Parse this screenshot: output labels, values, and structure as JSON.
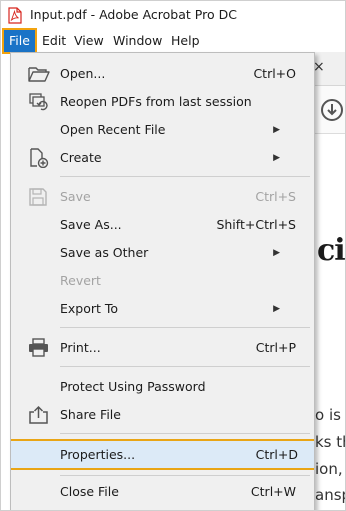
{
  "window": {
    "title": "Input.pdf - Adobe Acrobat Pro DC"
  },
  "menubar": {
    "file": "File",
    "edit": "Edit",
    "view": "View",
    "window": "Window",
    "help": "Help"
  },
  "background": {
    "tab_close": "×",
    "heading_fragment": "cia",
    "lines": [
      "o is a",
      "ks th",
      "ion,",
      "ansp"
    ]
  },
  "file_menu": {
    "items": [
      {
        "id": "open",
        "label": "Open...",
        "shortcut": "Ctrl+O",
        "icon": "folder-open-icon",
        "enabled": true
      },
      {
        "id": "reopen",
        "label": "Reopen PDFs from last session",
        "shortcut": "",
        "icon": "reopen-pdfs-icon",
        "enabled": true
      },
      {
        "id": "open-recent",
        "label": "Open Recent File",
        "shortcut": "",
        "icon": "",
        "submenu": true,
        "enabled": true
      },
      {
        "id": "create",
        "label": "Create",
        "shortcut": "",
        "icon": "create-pdf-icon",
        "submenu": true,
        "enabled": true
      },
      {
        "id": "save",
        "label": "Save",
        "shortcut": "Ctrl+S",
        "icon": "save-icon",
        "enabled": false
      },
      {
        "id": "save-as",
        "label": "Save As...",
        "shortcut": "Shift+Ctrl+S",
        "icon": "",
        "enabled": true
      },
      {
        "id": "save-as-other",
        "label": "Save as Other",
        "shortcut": "",
        "icon": "",
        "submenu": true,
        "enabled": true
      },
      {
        "id": "revert",
        "label": "Revert",
        "shortcut": "",
        "icon": "",
        "enabled": false
      },
      {
        "id": "export-to",
        "label": "Export To",
        "shortcut": "",
        "icon": "",
        "submenu": true,
        "enabled": true
      },
      {
        "id": "print",
        "label": "Print...",
        "shortcut": "Ctrl+P",
        "icon": "printer-icon",
        "enabled": true
      },
      {
        "id": "protect",
        "label": "Protect Using Password",
        "shortcut": "",
        "icon": "",
        "enabled": true
      },
      {
        "id": "share",
        "label": "Share File",
        "shortcut": "",
        "icon": "share-icon",
        "enabled": true
      },
      {
        "id": "properties",
        "label": "Properties...",
        "shortcut": "Ctrl+D",
        "icon": "",
        "enabled": true,
        "highlighted": true
      },
      {
        "id": "close",
        "label": "Close File",
        "shortcut": "Ctrl+W",
        "icon": "",
        "enabled": true
      }
    ]
  },
  "colors": {
    "accent_blue": "#1a73c7",
    "highlight_outline": "#e9a515",
    "disabled_text": "#a3a3a3",
    "pdf_red": "#d7261e"
  }
}
